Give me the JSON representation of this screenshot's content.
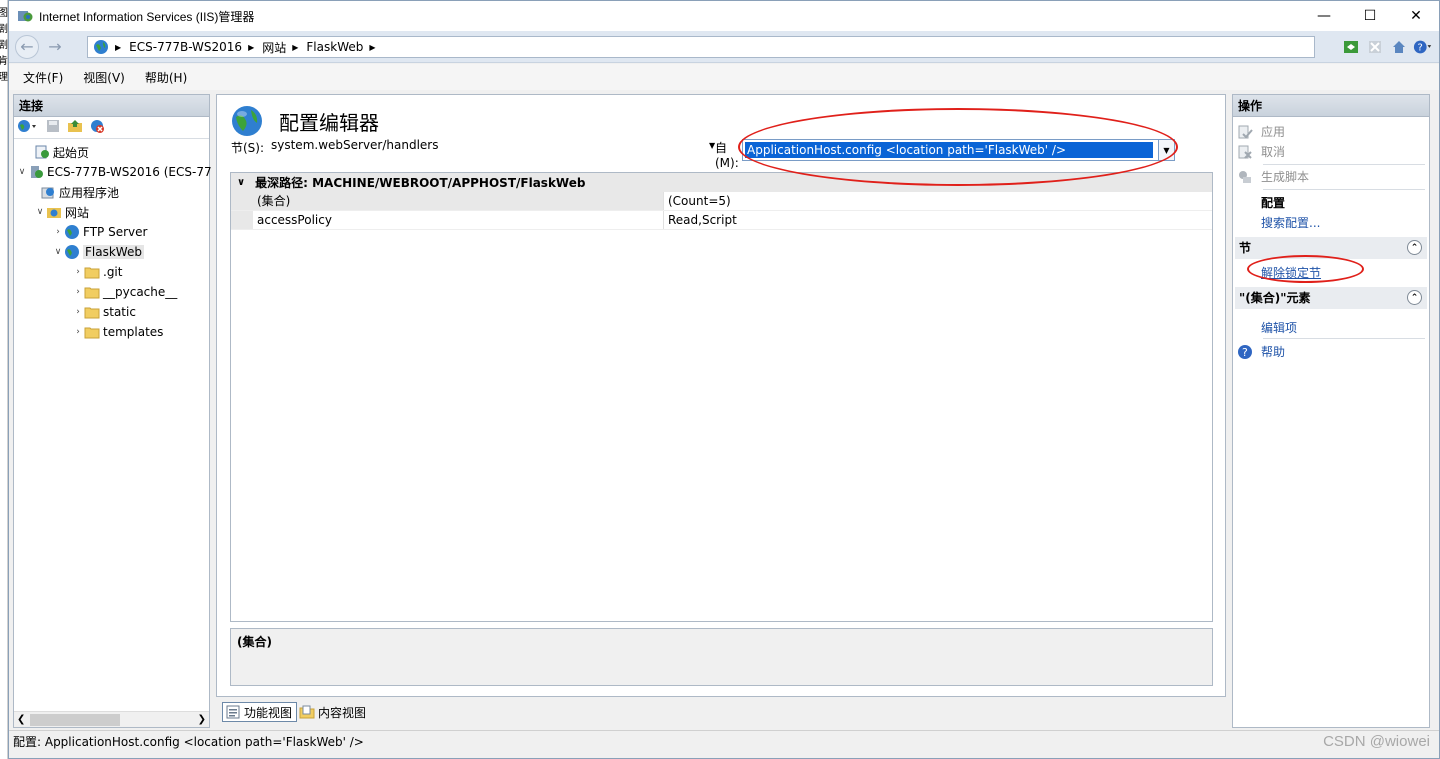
{
  "window": {
    "title": "Internet Information Services (IIS)管理器"
  },
  "addressbar": {
    "crumbs": [
      "ECS-777B-WS2016",
      "网站",
      "FlaskWeb"
    ]
  },
  "menubar": {
    "items": [
      "文件(F)",
      "视图(V)",
      "帮助(H)"
    ]
  },
  "connections": {
    "header": "连接",
    "tree": [
      {
        "label": "起始页",
        "icon": "start-page-icon"
      },
      {
        "label": "ECS-777B-WS2016 (ECS-77",
        "icon": "server-icon"
      },
      {
        "label": "应用程序池",
        "icon": "app-pool-icon"
      },
      {
        "label": "网站",
        "icon": "sites-folder-icon"
      },
      {
        "label": "FTP Server",
        "icon": "globe-icon"
      },
      {
        "label": "FlaskWeb",
        "icon": "globe-icon"
      },
      {
        "label": ".git",
        "icon": "folder-icon"
      },
      {
        "label": "__pycache__",
        "icon": "folder-icon"
      },
      {
        "label": "static",
        "icon": "folder-icon"
      },
      {
        "label": "templates",
        "icon": "folder-icon"
      }
    ]
  },
  "main": {
    "title": "配置编辑器",
    "section_label": "节(S):",
    "section_value": "system.webServer/handlers",
    "from_label": "自(M):",
    "from_value": "ApplicationHost.config <location path='FlaskWeb' />",
    "grid_header": "最深路径: MACHINE/WEBROOT/APPHOST/FlaskWeb",
    "rows": [
      {
        "key": "(集合)",
        "value": "(Count=5)"
      },
      {
        "key": "accessPolicy",
        "value": "Read,Script"
      }
    ],
    "description_title": "(集合)"
  },
  "view_tabs": [
    "功能视图",
    "内容视图"
  ],
  "actions": {
    "header": "操作",
    "apply": "应用",
    "cancel": "取消",
    "generate_script": "生成脚本",
    "config_heading": "配置",
    "search_config": "搜索配置...",
    "section_group": "节",
    "unlock_section": "解除锁定节",
    "collection_group": "\"(集合)\"元素",
    "edit_items": "编辑项",
    "help": "帮助"
  },
  "statusbar": {
    "text": "配置: ApplicationHost.config <location path='FlaskWeb' />"
  },
  "watermark": "CSDN @wiowei",
  "colors": {
    "highlight": "#0a64d6",
    "annotation": "#e0201a",
    "link": "#1f53a8"
  }
}
